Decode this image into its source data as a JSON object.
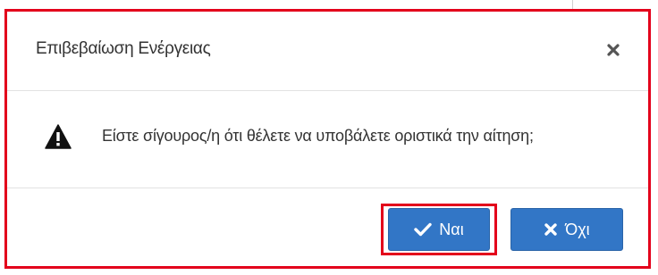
{
  "dialog": {
    "title": "Επιβεβαίωση Ενέργειας",
    "close_icon": "close-icon",
    "message": "Είστε σίγουρος/η ότι θέλετε να υποβάλετε οριστικά την αίτηση;",
    "warning_icon": "warning-icon",
    "buttons": {
      "yes_label": "Ναι",
      "yes_icon": "check-icon",
      "no_label": "Όχι",
      "no_icon": "x-icon"
    }
  },
  "colors": {
    "highlight": "#e3001b",
    "button_primary": "#3276c6",
    "text": "#333333"
  }
}
